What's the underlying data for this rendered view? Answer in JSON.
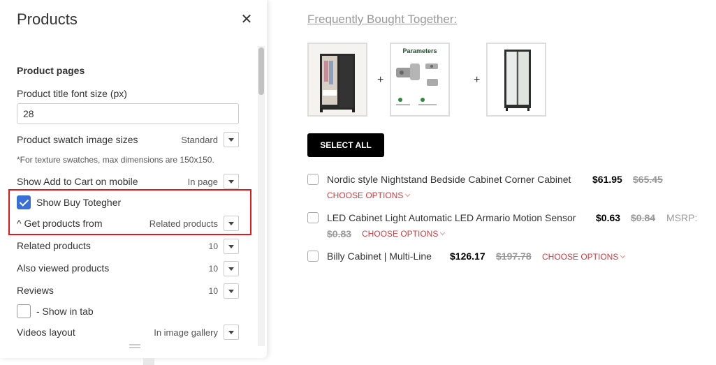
{
  "panel": {
    "title": "Products",
    "section_title": "Product pages",
    "title_font_size_label": "Product title font size (px)",
    "title_font_size_value": "28",
    "swatch_label": "Product swatch image sizes",
    "swatch_value": "Standard",
    "swatch_note": "*For texture swatches, max dimensions are 150x150.",
    "add_to_cart_label": "Show Add to Cart on mobile",
    "add_to_cart_value": "In page",
    "buy_together_label": "Show Buy Totegher",
    "buy_together_checked": true,
    "get_products_label": "^ Get products from",
    "get_products_value": "Related products",
    "related_label": "Related products",
    "related_value": "10",
    "also_viewed_label": "Also viewed products",
    "also_viewed_value": "10",
    "reviews_label": "Reviews",
    "reviews_value": "10",
    "show_in_tab_label": "- Show in tab",
    "show_in_tab_checked": false,
    "videos_label": "Videos layout",
    "videos_value": "In image gallery"
  },
  "fbt": {
    "title": "Frequently Bought Together:",
    "select_all": "SELECT ALL",
    "images": [
      "wardrobe-image",
      "hinge-parameters-image",
      "cabinet-image"
    ],
    "thumb_text": "Parameters",
    "plus": "+",
    "items": [
      {
        "name": "Nordic style Nightstand Bedside Cabinet Corner Cabinet",
        "price": "$61.95",
        "old_price": "$65.45",
        "choose": "CHOOSE OPTIONS"
      },
      {
        "name": "LED Cabinet Light Automatic LED Armario Motion Sensor",
        "price": "$0.63",
        "old_price": "$0.84",
        "msrp_label": "MSRP:",
        "msrp_value": "$0.83",
        "choose": "CHOOSE OPTIONS"
      },
      {
        "name": "Billy Cabinet | Multi-Line",
        "price": "$126.17",
        "old_price": "$197.78",
        "choose": "CHOOSE OPTIONS"
      }
    ]
  },
  "colors": {
    "accent_checkbox": "#3b6fd8",
    "highlight": "#e0191c",
    "choose_options": "#d9383f"
  }
}
